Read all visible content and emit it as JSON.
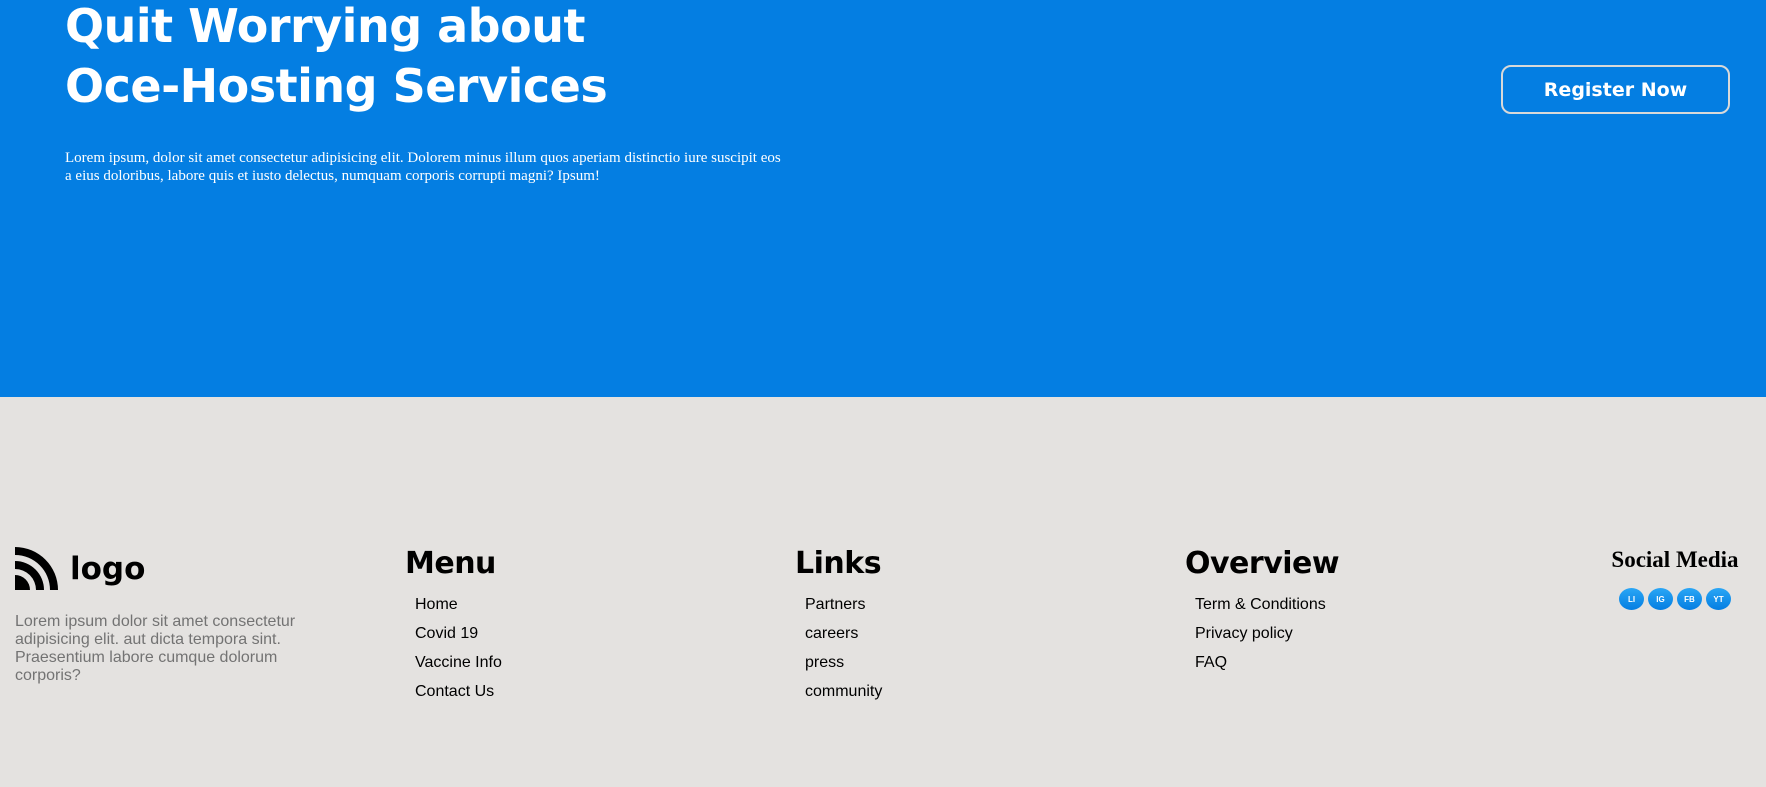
{
  "hero": {
    "title_line1": "Quit Worrying about",
    "title_line2": "Oce-Hosting Services",
    "description": "Lorem ipsum, dolor sit amet consectetur adipisicing elit. Dolorem minus illum quos aperiam distinctio iure suscipit eos a eius doloribus, labore quis et iusto delectus, numquam corporis corrupti magni? Ipsum!",
    "register_label": "Register Now"
  },
  "footer": {
    "brand": {
      "icon": "rss-feed-icon",
      "logo_text": "logo",
      "description": "Lorem ipsum dolor sit amet consectetur adipisicing elit. aut dicta tempora sint. Praesentium labore cumque dolorum corporis?"
    },
    "menu": {
      "heading": "Menu",
      "items": [
        "Home",
        "Covid 19",
        "Vaccine Info",
        "Contact Us"
      ]
    },
    "links": {
      "heading": "Links",
      "items": [
        "Partners",
        "careers",
        "press",
        "community"
      ]
    },
    "overview": {
      "heading": "Overview",
      "items": [
        "Term & Conditions",
        "Privacy policy",
        "FAQ"
      ]
    },
    "social": {
      "heading": "Social Media",
      "icons": [
        "LI",
        "IG",
        "FB",
        "YT"
      ]
    }
  },
  "colors": {
    "hero_background": "#047ee2",
    "footer_background": "#e4e2e0",
    "button_border": "#d9d9d9",
    "muted_text": "#737373"
  }
}
